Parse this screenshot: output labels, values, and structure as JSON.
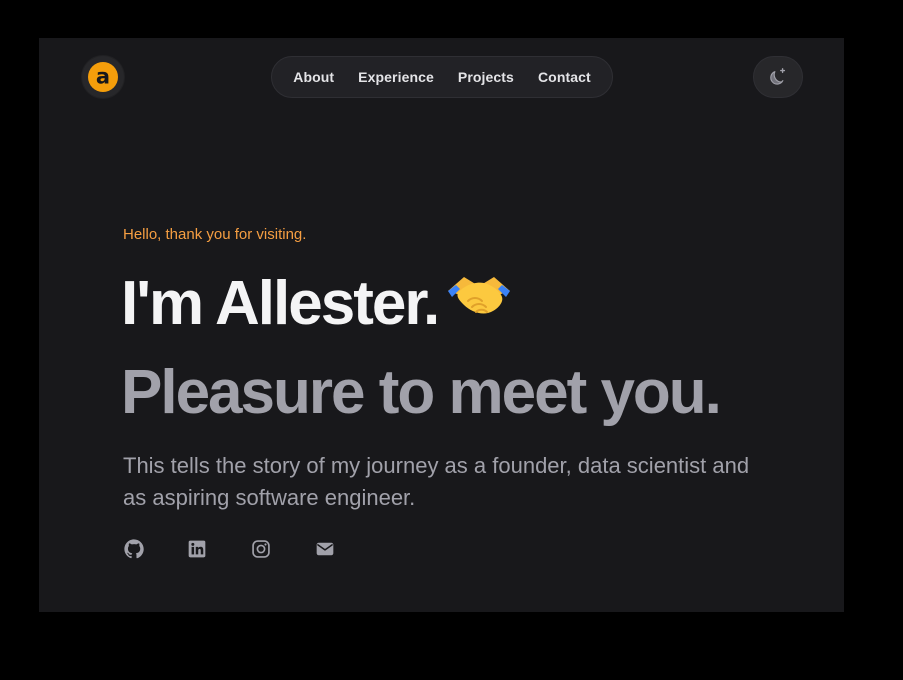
{
  "brand": {
    "logo_letter": "a",
    "accent_color": "#f59e0b"
  },
  "nav": {
    "items": [
      {
        "label": "About"
      },
      {
        "label": "Experience"
      },
      {
        "label": "Projects"
      },
      {
        "label": "Contact"
      }
    ]
  },
  "theme_toggle": {
    "icon": "moon-sparkle-icon"
  },
  "hero": {
    "greeting": "Hello, thank you for visiting.",
    "headline": "I'm Allester.",
    "headline_emoji": "handshake-emoji",
    "subheadline": "Pleasure to meet you.",
    "intro": "This tells the story of my journey as a founder, data scientist and as aspiring software engineer."
  },
  "socials": [
    {
      "icon": "github-icon"
    },
    {
      "icon": "linkedin-icon"
    },
    {
      "icon": "instagram-icon"
    },
    {
      "icon": "mail-icon"
    }
  ]
}
